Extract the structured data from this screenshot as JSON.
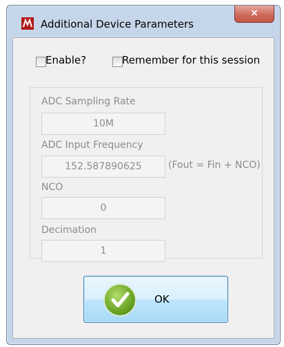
{
  "window": {
    "title": "Additional Device Parameters",
    "close_label": "×"
  },
  "options": {
    "enable_label": "Enable?",
    "enable_checked": false,
    "remember_label": "Remember for this session",
    "remember_checked": false
  },
  "params": {
    "adc_rate_label": "ADC Sampling Rate",
    "adc_rate_value": "10M",
    "adc_freq_label": "ADC Input  Frequency",
    "adc_freq_value": "152.587890625",
    "adc_freq_hint": "(Fout = Fin + NCO)",
    "nco_label": "NCO",
    "nco_value": "0",
    "decimation_label": "Decimation",
    "decimation_value": "1"
  },
  "ok_button": {
    "label": "OK"
  }
}
